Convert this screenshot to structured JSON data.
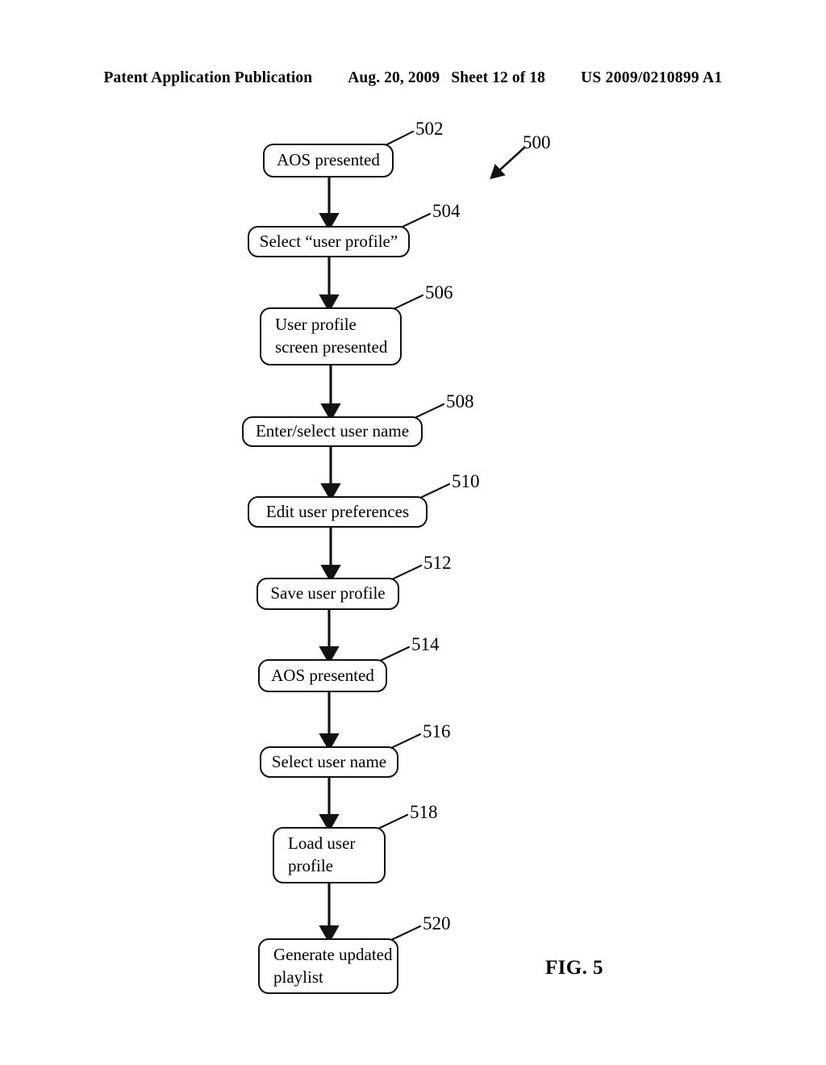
{
  "header": {
    "publication": "Patent Application Publication",
    "date": "Aug. 20, 2009",
    "sheet": "Sheet 12 of 18",
    "patent_number": "US 2009/0210899 A1"
  },
  "figure": {
    "caption": "FIG. 5",
    "diagram_label": "500"
  },
  "chart_data": {
    "type": "flowchart",
    "title": "FIG. 5",
    "diagram_reference": "500",
    "orientation": "top-to-bottom",
    "nodes": [
      {
        "ref": "502",
        "text": "AOS presented",
        "lines": [
          "AOS presented"
        ]
      },
      {
        "ref": "504",
        "text": "Select “user profile”",
        "lines": [
          "Select “user profile”"
        ]
      },
      {
        "ref": "506",
        "text": "User profile screen presented",
        "lines": [
          "User profile",
          "screen presented"
        ]
      },
      {
        "ref": "508",
        "text": "Enter/select user name",
        "lines": [
          "Enter/select user name"
        ]
      },
      {
        "ref": "510",
        "text": "Edit user preferences",
        "lines": [
          "Edit user preferences"
        ]
      },
      {
        "ref": "512",
        "text": "Save user profile",
        "lines": [
          "Save user profile"
        ]
      },
      {
        "ref": "514",
        "text": "AOS presented",
        "lines": [
          "AOS presented"
        ]
      },
      {
        "ref": "516",
        "text": "Select user name",
        "lines": [
          "Select user name"
        ]
      },
      {
        "ref": "518",
        "text": "Load user profile",
        "lines": [
          "Load user",
          "profile"
        ]
      },
      {
        "ref": "520",
        "text": "Generate updated playlist",
        "lines": [
          "Generate updated",
          "playlist"
        ]
      }
    ],
    "edges": [
      {
        "from": "502",
        "to": "504"
      },
      {
        "from": "504",
        "to": "506"
      },
      {
        "from": "506",
        "to": "508"
      },
      {
        "from": "508",
        "to": "510"
      },
      {
        "from": "510",
        "to": "512"
      },
      {
        "from": "512",
        "to": "514"
      },
      {
        "from": "514",
        "to": "516"
      },
      {
        "from": "516",
        "to": "518"
      },
      {
        "from": "518",
        "to": "520"
      }
    ]
  },
  "nodes": {
    "n502": {
      "ref": "502",
      "l1": "AOS presented"
    },
    "n504": {
      "ref": "504",
      "l1": "Select “user profile”"
    },
    "n506": {
      "ref": "506",
      "l1": "User profile",
      "l2": "screen presented"
    },
    "n508": {
      "ref": "508",
      "l1": "Enter/select user name"
    },
    "n510": {
      "ref": "510",
      "l1": "Edit user preferences"
    },
    "n512": {
      "ref": "512",
      "l1": "Save user profile"
    },
    "n514": {
      "ref": "514",
      "l1": "AOS presented"
    },
    "n516": {
      "ref": "516",
      "l1": "Select user name"
    },
    "n518": {
      "ref": "518",
      "l1": "Load user",
      "l2": "profile"
    },
    "n520": {
      "ref": "520",
      "l1": "Generate updated",
      "l2": "playlist"
    }
  }
}
